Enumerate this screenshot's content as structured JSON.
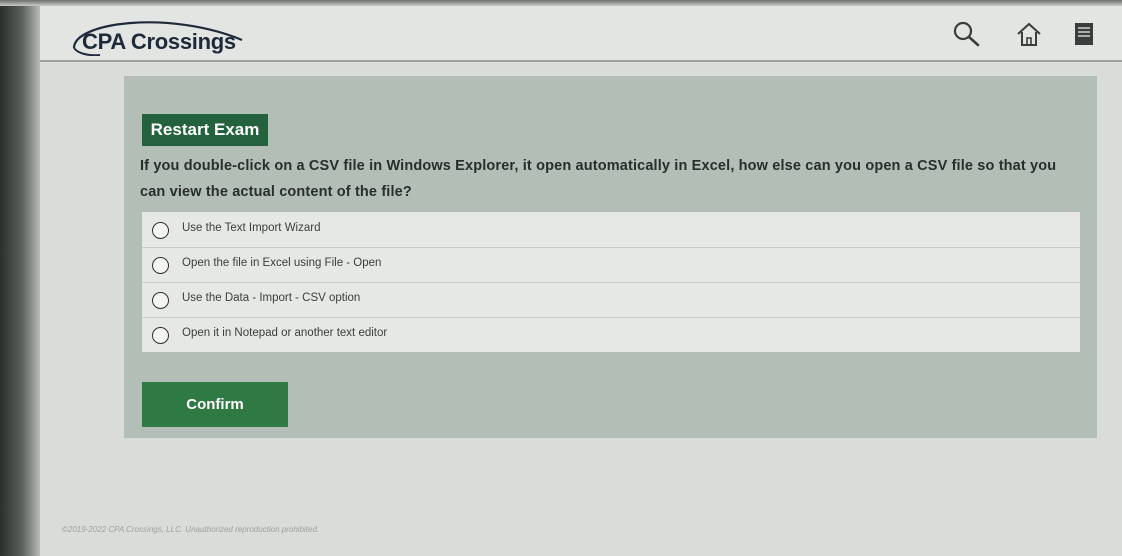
{
  "header": {
    "logo_text": "CPA Crossings",
    "icons": [
      "search-icon",
      "home-icon",
      "notes-icon"
    ]
  },
  "exam": {
    "restart_label": "Restart Exam",
    "question": "If you double-click on a CSV file in Windows Explorer, it open automatically in Excel, how else can you open a CSV file so that you can view the actual content of the file?",
    "options": [
      "Use the Text Import Wizard",
      "Open the file in Excel using File - Open",
      "Use the Data - Import - CSV option",
      "Open it in Notepad or another text editor"
    ],
    "confirm_label": "Confirm"
  },
  "colors": {
    "brand_green": "#23623d",
    "confirm_green": "#2f7a44",
    "panel": "#b2beb6"
  },
  "footer": {
    "copyright": "©2019-2022 CPA Crossings, LLC. Unauthorized reproduction prohibited."
  }
}
